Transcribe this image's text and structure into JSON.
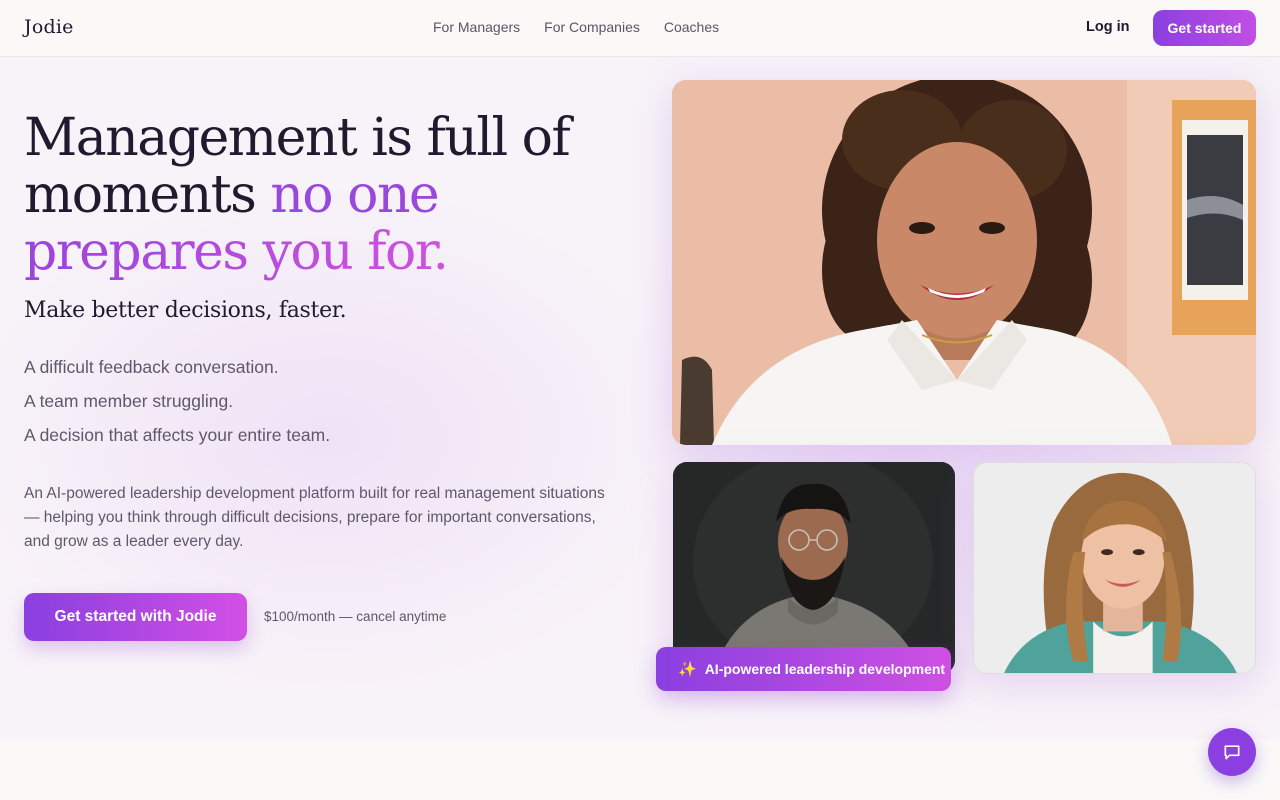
{
  "header": {
    "logo": "Jodie",
    "nav": [
      "For Managers",
      "For Companies",
      "Coaches"
    ],
    "login": "Log in",
    "cta": "Get started"
  },
  "hero": {
    "headline_part1": "Management is full of",
    "headline_part2": "moments ",
    "headline_accent1": "no one",
    "headline_accent2": "prepares you for.",
    "subhead": "Make better decisions, faster.",
    "moments": [
      "A difficult feedback conversation.",
      "A team member struggling.",
      "A decision that affects your entire team."
    ],
    "description": "An AI-powered leadership development platform built for real management situations — helping you think through difficult decisions, prepare for important conversations, and grow as a leader every day.",
    "cta": "Get started with Jodie",
    "price_note": "$100/month — cancel anytime"
  },
  "badge": {
    "icon": "sparkles-icon",
    "label": "AI-powered leadership development"
  },
  "chat": {
    "icon": "chat-bubble-icon"
  },
  "colors": {
    "accent": "#8b3fe0",
    "accent_end": "#cf50e3",
    "text": "#1f1a2e",
    "muted": "#5f586b"
  }
}
